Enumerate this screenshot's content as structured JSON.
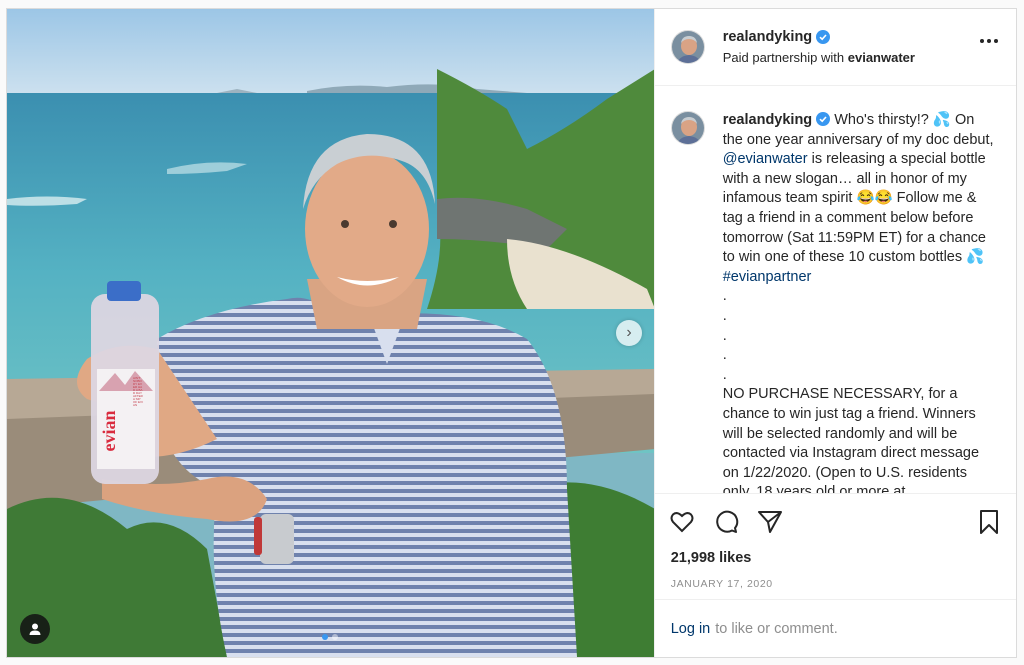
{
  "post": {
    "username": "realandyking",
    "partnership_prefix": "Paid partnership with",
    "partner_name": "evianwater",
    "more_icon": "more-options-icon",
    "caption": {
      "username": "realandyking",
      "text_before_mention": "Who's thirsty!? 💦 On the one year anniversary of my doc debut, ",
      "mention": "@evianwater",
      "text_after_mention": " is releasing a special bottle with a new slogan… all in honor of my infamous team spirit 😂😂 Follow me & tag a friend in a comment below before tomorrow (Sat 11:59PM ET) for a chance to win one of these 10 custom bottles 💦 ",
      "hashtag": "#evianpartner",
      "dots": "\n.\n.\n.\n.\n.\n",
      "rules_text": "NO PURCHASE NECESSARY, for a chance to win just tag a friend. Winners will be selected randomly and will be contacted via Instagram direct message on 1/22/2020. (Open to U.S. residents only, 18 years old or more at"
    },
    "likes": "21,998 likes",
    "date": "JANUARY 17, 2020",
    "login_link": "Log in",
    "login_suffix": "to like or comment.",
    "bottle_brand": "evian",
    "bottle_slogan": "AIN'T NOBODY EVER HAD A BAD DAY AFTER A SIP OF EVIAN",
    "carousel": {
      "total": 2,
      "active": 1
    },
    "colors": {
      "verified": "#3897f0",
      "link": "#00376b",
      "muted": "#8e8e8e"
    }
  }
}
